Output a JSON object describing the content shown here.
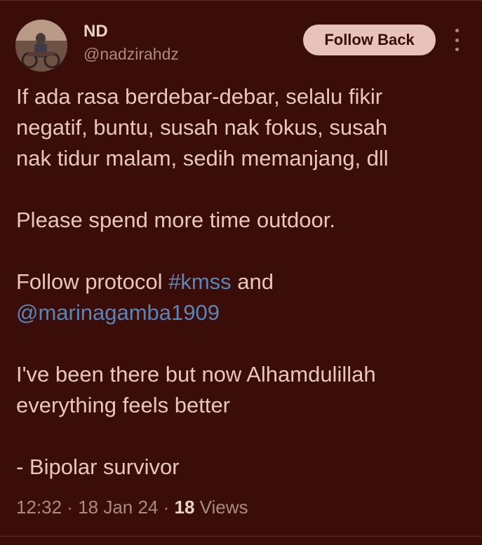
{
  "author": {
    "display_name": "ND",
    "handle": "@nadzirahdz"
  },
  "actions": {
    "follow_label": "Follow Back",
    "more_icon": "more-vertical-icon"
  },
  "tweet": {
    "line1": "If ada rasa berdebar-debar, selalu fikir",
    "line2": "negatif, buntu, susah nak fokus, susah",
    "line3": "nak tidur malam, sedih memanjang, dll",
    "line4": "Please spend more time outdoor.",
    "line5_prefix": "Follow protocol ",
    "hashtag": "#kmss",
    "line5_suffix": " and",
    "mention": "@marinagamba1909",
    "line6": "I've been there but now Alhamdulillah",
    "line7": "everything feels better",
    "line8": "- Bipolar survivor"
  },
  "meta": {
    "time": "12:32",
    "separator1": " · ",
    "date": "18 Jan 24",
    "separator2": " · ",
    "views_count": "18",
    "views_label": " Views"
  },
  "colors": {
    "background": "#3a0d09",
    "text": "#e8c7bf",
    "muted": "#a98a84",
    "link": "#5b84b8",
    "button": "#e8c3bc"
  }
}
